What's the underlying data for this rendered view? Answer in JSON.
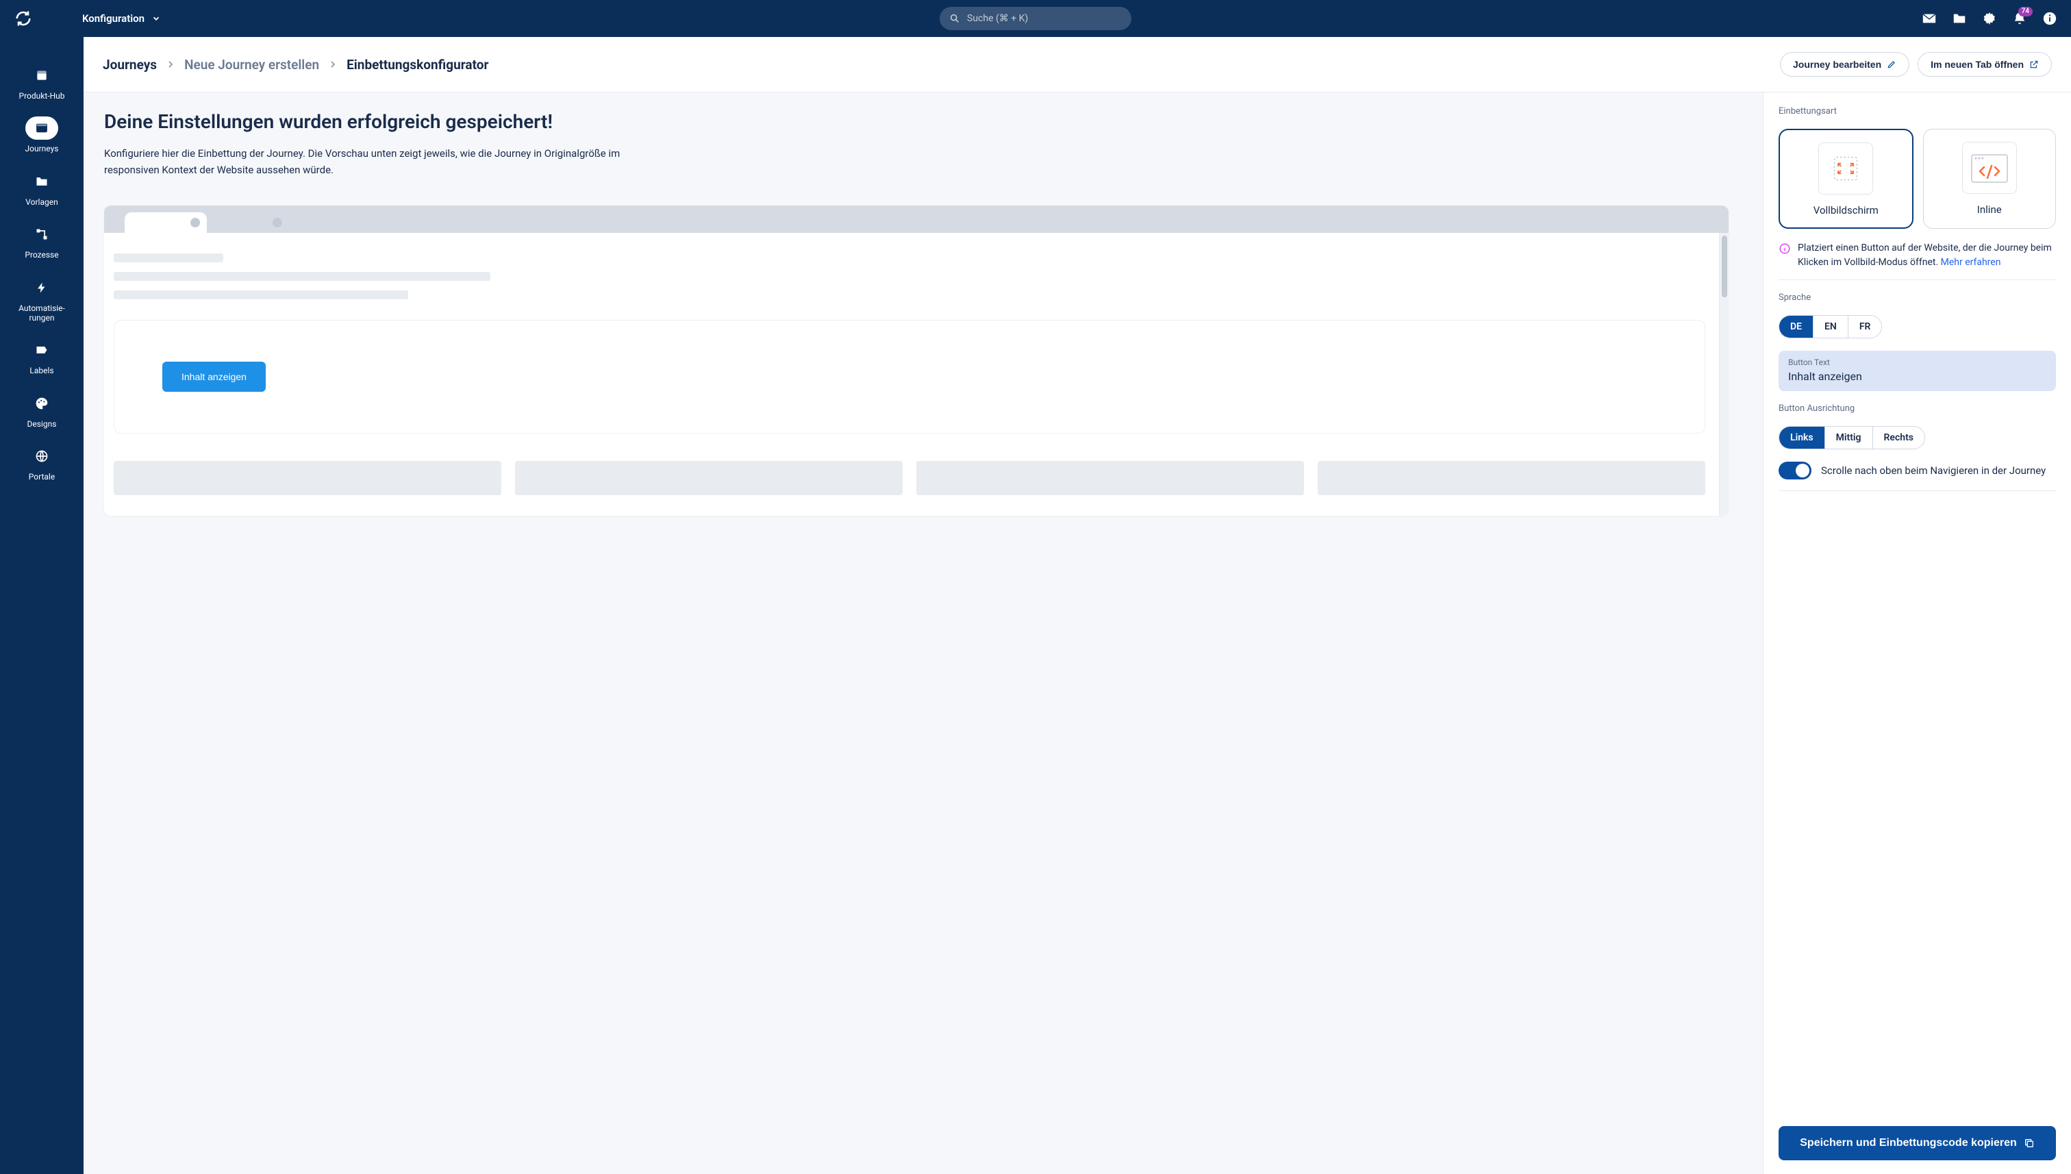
{
  "topbar": {
    "config_label": "Konfiguration",
    "search_placeholder": "Suche (⌘ + K)",
    "notification_count": "74"
  },
  "sidebar": {
    "items": [
      {
        "label": "Produkt-Hub",
        "icon": "package"
      },
      {
        "label": "Journeys",
        "icon": "layout",
        "active": true
      },
      {
        "label": "Vorlagen",
        "icon": "folder"
      },
      {
        "label": "Prozesse",
        "icon": "workflow"
      },
      {
        "label": "Automatisie­rungen",
        "icon": "bolt"
      },
      {
        "label": "Labels",
        "icon": "tag"
      },
      {
        "label": "Designs",
        "icon": "palette"
      },
      {
        "label": "Portale",
        "icon": "globe"
      }
    ]
  },
  "breadcrumb": {
    "l0": "Journeys",
    "l1": "Neue Journey erstellen",
    "l2": "Einbettungskonfigurator"
  },
  "header_actions": {
    "edit_label": "Journey bearbeiten",
    "open_tab_label": "Im neuen Tab öffnen"
  },
  "content": {
    "heading": "Deine Einstellungen wurden erfolgreich gespeichert!",
    "description": "Konfiguriere hier die Einbettung der Journey. Die Vorschau unten zeigt jeweils, wie die Journey in Originalgröße im responsiven Kontext der Website aussehen würde.",
    "preview_button": "Inhalt anzeigen"
  },
  "config": {
    "embed_type_label": "Einbettungsart",
    "types": {
      "fullscreen": "Vollbildschirm",
      "inline": "Inline"
    },
    "info_text": "Platziert einen Button auf der Website, der die Journey beim Klicken im Vollbild-Modus öffnet. ",
    "info_link": "Mehr erfahren",
    "language_label": "Sprache",
    "languages": {
      "de": "DE",
      "en": "EN",
      "fr": "FR"
    },
    "button_text_label": "Button Text",
    "button_text_value": "Inhalt anzeigen",
    "alignment_label": "Button Ausrichtung",
    "alignments": {
      "left": "Links",
      "center": "Mittig",
      "right": "Rechts"
    },
    "scroll_toggle_label": "Scrolle nach oben beim Navigieren in der Journey",
    "save_button": "Speichern und Einbettungscode kopieren"
  }
}
